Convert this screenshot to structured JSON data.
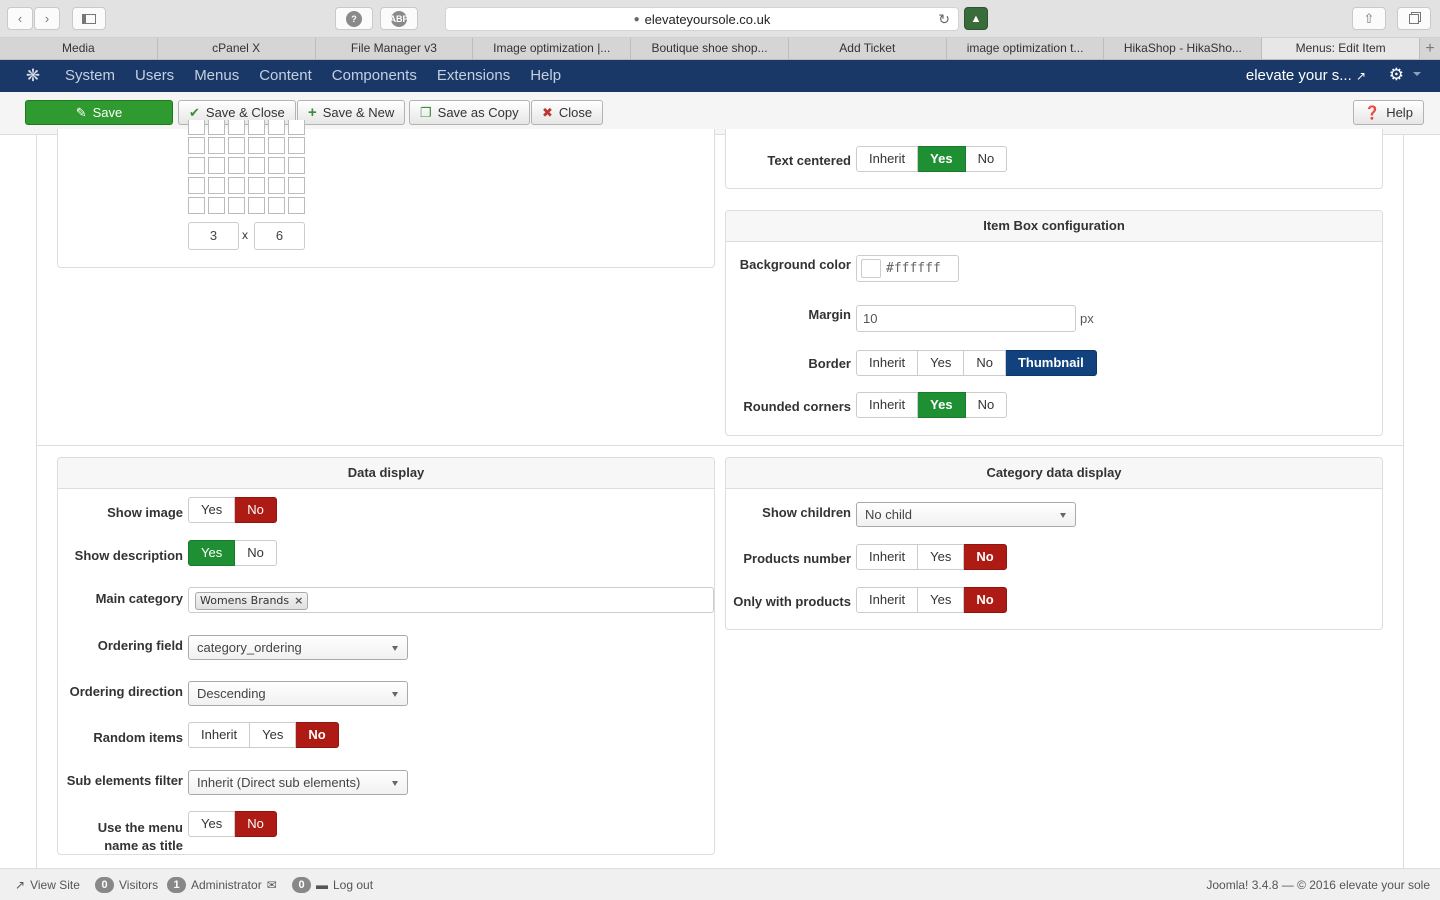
{
  "browser": {
    "url": "elevateyoursole.co.uk",
    "tabs": [
      "Media",
      "cPanel X",
      "File Manager v3",
      "Image optimization |...",
      "Boutique shoe shop...",
      "Add Ticket",
      "image optimization t...",
      "HikaShop - HikaSho...",
      "Menus: Edit Item"
    ],
    "active_tab": "Menus: Edit Item",
    "abp_label": "ABP"
  },
  "nav": {
    "menu": [
      "System",
      "Users",
      "Menus",
      "Content",
      "Components",
      "Extensions",
      "Help"
    ],
    "site_name": "elevate your s..."
  },
  "toolbar": {
    "save": "Save",
    "save_close": "Save & Close",
    "save_new": "Save & New",
    "save_copy": "Save as Copy",
    "close": "Close",
    "help": "Help"
  },
  "layout_grid": {
    "rows_value": "3",
    "x": "x",
    "cols_value": "6"
  },
  "text_centered": {
    "label": "Text centered",
    "options": [
      "Inherit",
      "Yes",
      "No"
    ],
    "selected": "Yes"
  },
  "item_box": {
    "title": "Item Box configuration",
    "bg_label": "Background color",
    "bg_value": "#ffffff",
    "margin_label": "Margin",
    "margin_value": "10",
    "margin_unit": "px",
    "border_label": "Border",
    "border_options": [
      "Inherit",
      "Yes",
      "No",
      "Thumbnail"
    ],
    "border_selected": "Thumbnail",
    "rounded_label": "Rounded corners",
    "rounded_options": [
      "Inherit",
      "Yes",
      "No"
    ],
    "rounded_selected": "Yes"
  },
  "data_display": {
    "title": "Data display",
    "show_image_label": "Show image",
    "show_image_options": [
      "Yes",
      "No"
    ],
    "show_image_selected": "No",
    "show_desc_label": "Show description",
    "show_desc_options": [
      "Yes",
      "No"
    ],
    "show_desc_selected": "Yes",
    "main_cat_label": "Main category",
    "main_cat_chip": "Womens Brands",
    "ordering_field_label": "Ordering field",
    "ordering_field_value": "category_ordering",
    "ordering_dir_label": "Ordering direction",
    "ordering_dir_value": "Descending",
    "random_label": "Random items",
    "random_options": [
      "Inherit",
      "Yes",
      "No"
    ],
    "random_selected": "No",
    "sub_filter_label": "Sub elements filter",
    "sub_filter_value": "Inherit (Direct sub elements)",
    "menu_title_label_1": "Use the menu",
    "menu_title_label_2": "name as title",
    "menu_title_options": [
      "Yes",
      "No"
    ],
    "menu_title_selected": "No"
  },
  "category_display": {
    "title": "Category data display",
    "show_children_label": "Show children",
    "show_children_value": "No child",
    "products_number_label": "Products number",
    "products_number_options": [
      "Inherit",
      "Yes",
      "No"
    ],
    "products_number_selected": "No",
    "only_products_label": "Only with products",
    "only_products_options": [
      "Inherit",
      "Yes",
      "No"
    ],
    "only_products_selected": "No"
  },
  "status": {
    "view_site": "View Site",
    "visitors_count": "0",
    "visitors": "Visitors",
    "admin_count": "1",
    "admin": "Administrator",
    "msg_count": "0",
    "logout": "Log out",
    "version": "Joomla! 3.4.8  —  © 2016 elevate your sole"
  },
  "colors": {
    "nav_bg": "#1a3867",
    "green": "#1f8f34",
    "red": "#ad1b14",
    "blue": "#11427d"
  }
}
